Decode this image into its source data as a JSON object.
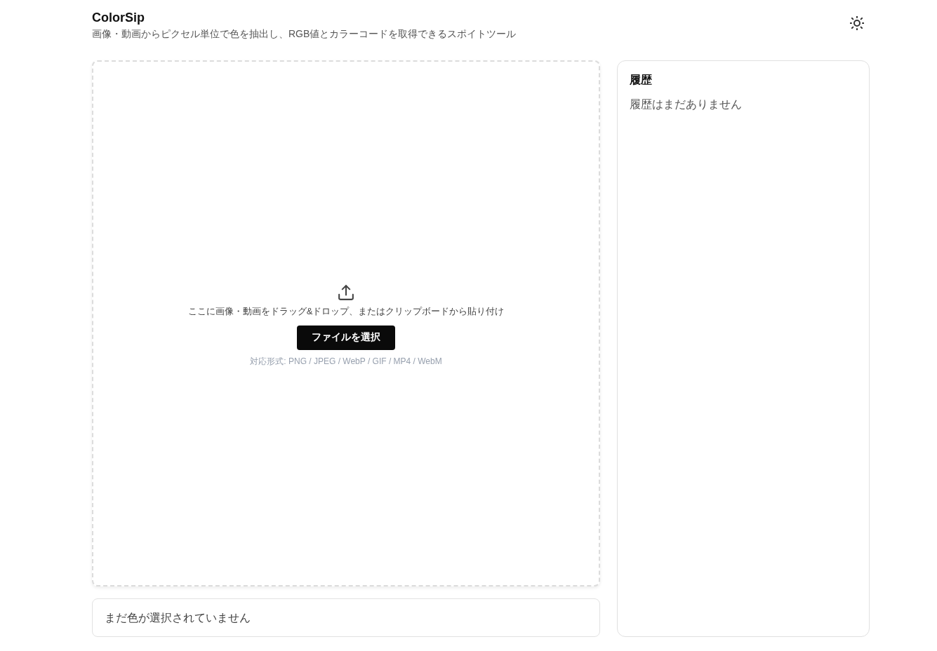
{
  "header": {
    "title": "ColorSip",
    "subtitle": "画像・動画からピクセル単位で色を抽出し、RGB値とカラーコードを取得できるスポイトツール"
  },
  "dropzone": {
    "prompt": "ここに画像・動画をドラッグ&ドロップ、またはクリップボードから貼り付け",
    "button": "ファイルを選択",
    "formats": "対応形式: PNG / JPEG / WebP / GIF / MP4 / WebM"
  },
  "color_panel": {
    "empty_message": "まだ色が選択されていません"
  },
  "history": {
    "title": "履歴",
    "empty_message": "履歴はまだありません"
  }
}
